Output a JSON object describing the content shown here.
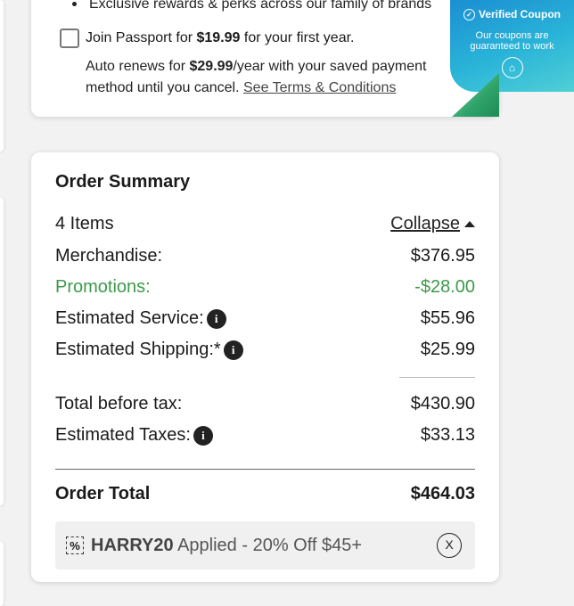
{
  "passport": {
    "perk_text": "Exclusive rewards & perks across our family of brands",
    "join_prefix": "Join Passport for ",
    "join_price": "$19.99",
    "join_suffix": " for your first year.",
    "renew_prefix": "Auto renews for ",
    "renew_price": "$29.99",
    "renew_suffix": "/year with your saved payment method until you cancel. ",
    "terms_link": "See Terms & Conditions"
  },
  "coupon_badge": {
    "title": "Verified Coupon",
    "subtitle_line1": "Our coupons are",
    "subtitle_line2": "guaranteed to work"
  },
  "summary": {
    "title": "Order Summary",
    "items_label": "4 Items",
    "collapse_label": "Collapse",
    "merchandise_label": "Merchandise:",
    "merchandise_value": "$376.95",
    "promotions_label": "Promotions:",
    "promotions_value": "-$28.00",
    "service_label": "Estimated Service:",
    "service_value": "$55.96",
    "shipping_label": "Estimated Shipping:*",
    "shipping_value": "$25.99",
    "before_tax_label": "Total before tax:",
    "before_tax_value": "$430.90",
    "taxes_label": "Estimated Taxes:",
    "taxes_value": "$33.13",
    "order_total_label": "Order Total",
    "order_total_value": "$464.03",
    "info_glyph": "i"
  },
  "promo": {
    "icon_glyph": "%",
    "code": "HARRY20",
    "applied_text": " Applied - 20% Off $45+",
    "remove_glyph": "X"
  },
  "colors": {
    "promotion_green": "#3c9a4a",
    "badge_blue": "#1a8fd2",
    "badge_teal": "#4fd0d6"
  }
}
